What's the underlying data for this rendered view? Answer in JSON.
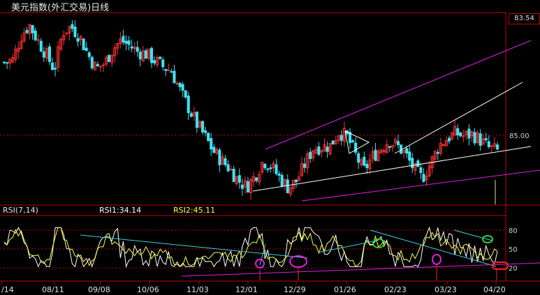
{
  "window": {
    "title": "美元指数(外汇交易)日线"
  },
  "price_readout": "83.54",
  "indicator": {
    "name": "RSI(7,14)",
    "rsi1": "RSI1:34.14",
    "rsi2": "RSI2:45.11"
  },
  "colors": {
    "background": "#000000",
    "grid_red": "#c00000",
    "up_candle": "#ff3030",
    "down_candle": "#40e0f0",
    "channel_magenta": "#e020e0",
    "trend_white": "#ffffff",
    "rsi1_white": "#ffffff",
    "rsi2_yellow": "#ffff40",
    "rsi_trend_cyan": "#40d0e0",
    "marker_green": "#30d030",
    "marker_magenta": "#e020e0",
    "marker_red": "#ff2020"
  },
  "chart_data": [
    {
      "type": "candlestick",
      "title": "美元指数(外汇交易)日线",
      "xlabel": "",
      "ylabel": "",
      "x_tick_labels": [
        "/14",
        "08/11",
        "09/08",
        "10/06",
        "11/03",
        "12/01",
        "12/29",
        "01/26",
        "02/23",
        "03/23",
        "04/20"
      ],
      "y_tick_labels": [
        "85.00"
      ],
      "y_level": 85.0,
      "last_price": 83.54,
      "close_path": [
        91.9,
        92.1,
        94.4,
        95.5,
        94.0,
        92.7,
        91.2,
        94.8,
        95.3,
        94.4,
        92.7,
        91.3,
        91.8,
        93.2,
        94.0,
        93.5,
        92.9,
        92.7,
        92.1,
        91.5,
        91.1,
        89.3,
        87.7,
        86.1,
        84.9,
        83.5,
        82.6,
        81.8,
        80.7,
        80.1,
        81.1,
        82.6,
        82.0,
        80.9,
        80.0,
        80.7,
        82.3,
        83.8,
        83.9,
        84.0,
        85.3,
        84.9,
        83.2,
        81.6,
        82.9,
        83.7,
        84.5,
        84.0,
        83.2,
        81.8,
        80.9,
        82.3,
        84.0,
        84.7,
        85.2,
        84.9,
        85.1,
        84.5,
        83.8,
        83.5
      ],
      "gridlines": "horizontal dashed at 85.00 and at 80 (RSI)"
    },
    {
      "type": "line",
      "title": "RSI(7,14)",
      "series": [
        {
          "name": "RSI1",
          "last": 34.14
        },
        {
          "name": "RSI2",
          "last": 45.11
        }
      ],
      "y_tick_labels": [
        "80",
        "50",
        "20"
      ],
      "ylim": [
        0,
        100
      ]
    }
  ]
}
